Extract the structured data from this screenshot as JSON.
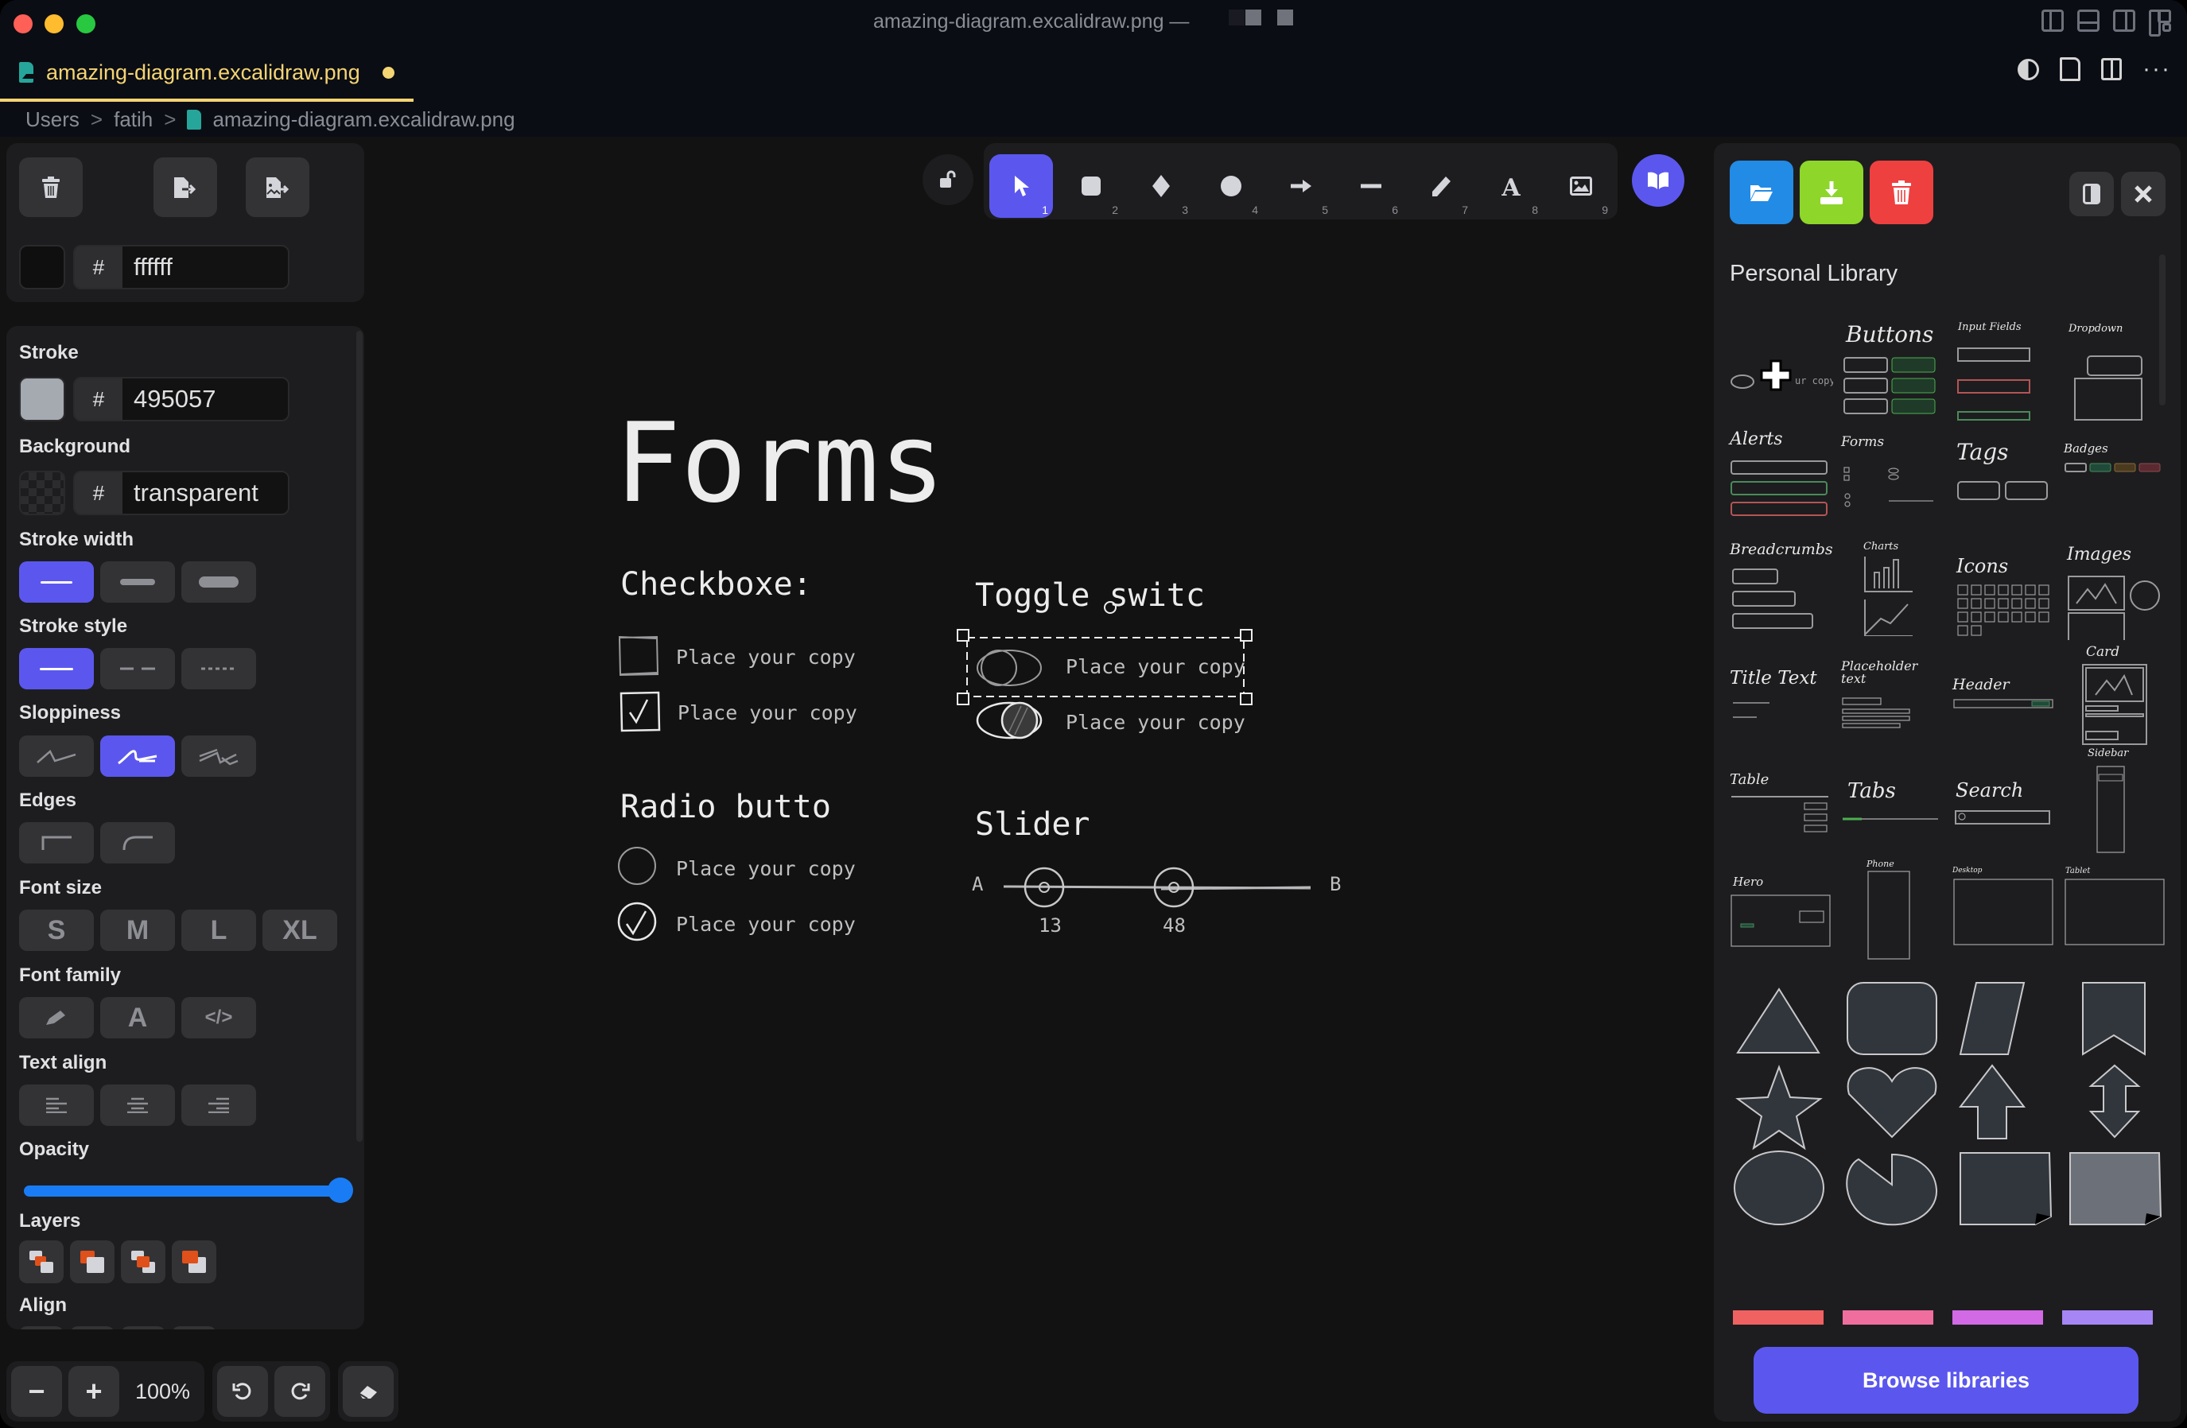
{
  "window": {
    "title": "amazing-diagram.excalidraw.png —",
    "traffic_lights": [
      "close",
      "minimize",
      "zoom"
    ],
    "layout_icons": [
      "toggle-primary-sidebar-icon",
      "toggle-panel-icon",
      "toggle-secondary-sidebar-icon",
      "customize-layout-icon"
    ]
  },
  "tab": {
    "label": "amazing-diagram.excalidraw.png",
    "dirty": true,
    "accent": "#f4d473",
    "actions": [
      "theme-toggle-icon",
      "open-file-icon",
      "split-editor-icon",
      "more-actions-icon"
    ]
  },
  "breadcrumb": {
    "items": [
      "Users",
      "fatih",
      "amazing-diagram.excalidraw.png"
    ],
    "separator": ">"
  },
  "left_panel": {
    "top_actions": [
      "delete-icon",
      "export-file-icon",
      "export-image-icon"
    ],
    "canvas_bg": {
      "hash": "#",
      "value": "ffffff",
      "swatch": "#0f0f10"
    },
    "stroke": {
      "label": "Stroke",
      "hash": "#",
      "value": "495057",
      "swatch": "#a5a9b0"
    },
    "background": {
      "label": "Background",
      "hash": "#",
      "value": "transparent"
    },
    "stroke_width": {
      "label": "Stroke width",
      "options": [
        "thin",
        "bold",
        "extra-bold"
      ],
      "selected": 0
    },
    "stroke_style": {
      "label": "Stroke style",
      "options": [
        "solid",
        "dashed",
        "dotted"
      ],
      "selected": 0
    },
    "sloppiness": {
      "label": "Sloppiness",
      "options": [
        "architect",
        "artist",
        "cartoonist"
      ],
      "selected": 1
    },
    "edges": {
      "label": "Edges",
      "options": [
        "sharp",
        "round"
      ]
    },
    "font_size": {
      "label": "Font size",
      "options": [
        "S",
        "M",
        "L",
        "XL"
      ]
    },
    "font_family": {
      "label": "Font family",
      "options": [
        "hand-drawn",
        "normal",
        "code"
      ],
      "normal_glyph": "A",
      "code_glyph": "</>"
    },
    "text_align": {
      "label": "Text align",
      "options": [
        "left",
        "center",
        "right"
      ]
    },
    "opacity": {
      "label": "Opacity",
      "value_percent": 100
    },
    "layers": {
      "label": "Layers",
      "options": [
        "send-to-back",
        "send-backward",
        "bring-forward",
        "bring-to-front"
      ]
    },
    "align": {
      "label": "Align"
    }
  },
  "zoom_bar": {
    "zoom_out": "−",
    "zoom_in": "+",
    "zoom_level": "100%",
    "undo": "undo-icon",
    "redo": "redo-icon",
    "eraser": "eraser-icon"
  },
  "toolbar": {
    "lock": "unlock-icon",
    "tools": [
      {
        "name": "selection",
        "key": "1",
        "active": true
      },
      {
        "name": "rectangle",
        "key": "2"
      },
      {
        "name": "diamond",
        "key": "3"
      },
      {
        "name": "ellipse",
        "key": "4"
      },
      {
        "name": "arrow",
        "key": "5"
      },
      {
        "name": "line",
        "key": "6"
      },
      {
        "name": "draw",
        "key": "7"
      },
      {
        "name": "text",
        "key": "8"
      },
      {
        "name": "image",
        "key": "9"
      }
    ],
    "library": "library-icon",
    "accent": "#5b57ee"
  },
  "canvas": {
    "title": "Forms",
    "checkboxes": {
      "heading": "Checkboxe:",
      "items": [
        {
          "label": "Place your copy",
          "checked": false
        },
        {
          "label": "Place your copy",
          "checked": true
        }
      ]
    },
    "toggles": {
      "heading": "Toggle switc",
      "items": [
        {
          "label": "Place your copy",
          "on": false,
          "selected": true
        },
        {
          "label": "Place your copy",
          "on": true
        }
      ]
    },
    "radios": {
      "heading": "Radio butto",
      "items": [
        {
          "label": "Place your copy",
          "checked": false
        },
        {
          "label": "Place your copy",
          "checked": true
        }
      ]
    },
    "slider": {
      "heading": "Slider",
      "min_label": "A",
      "max_label": "B",
      "values": [
        "13",
        "48"
      ]
    }
  },
  "library": {
    "actions": [
      "open-library-icon",
      "download-library-icon",
      "clear-library-icon"
    ],
    "action_colors": [
      "#228be6",
      "#8ed62a",
      "#ef4040"
    ],
    "title": "Personal Library",
    "items": [
      "Buttons",
      "Input Fields",
      "Dropdown",
      "Alerts",
      "Forms",
      "Tags",
      "Badges",
      "Breadcrumbs",
      "Charts",
      "Icons",
      "Images",
      "Title Text",
      "Placeholder text",
      "Header",
      "Card",
      "Table",
      "Tabs",
      "Search",
      "Sidebar",
      "Hero",
      "Phone",
      "Desktop",
      "Tablet"
    ],
    "shapes": [
      "triangle",
      "rounded-rectangle",
      "parallelogram",
      "bookmark",
      "star",
      "heart",
      "arrow-up",
      "arrow-up-down",
      "circle",
      "pie",
      "sticky-note",
      "sticky-note-gray"
    ],
    "swatches": [
      "#f06161",
      "#f06e9e",
      "#d26ae6",
      "#a685f5"
    ],
    "browse_label": "Browse libraries"
  }
}
